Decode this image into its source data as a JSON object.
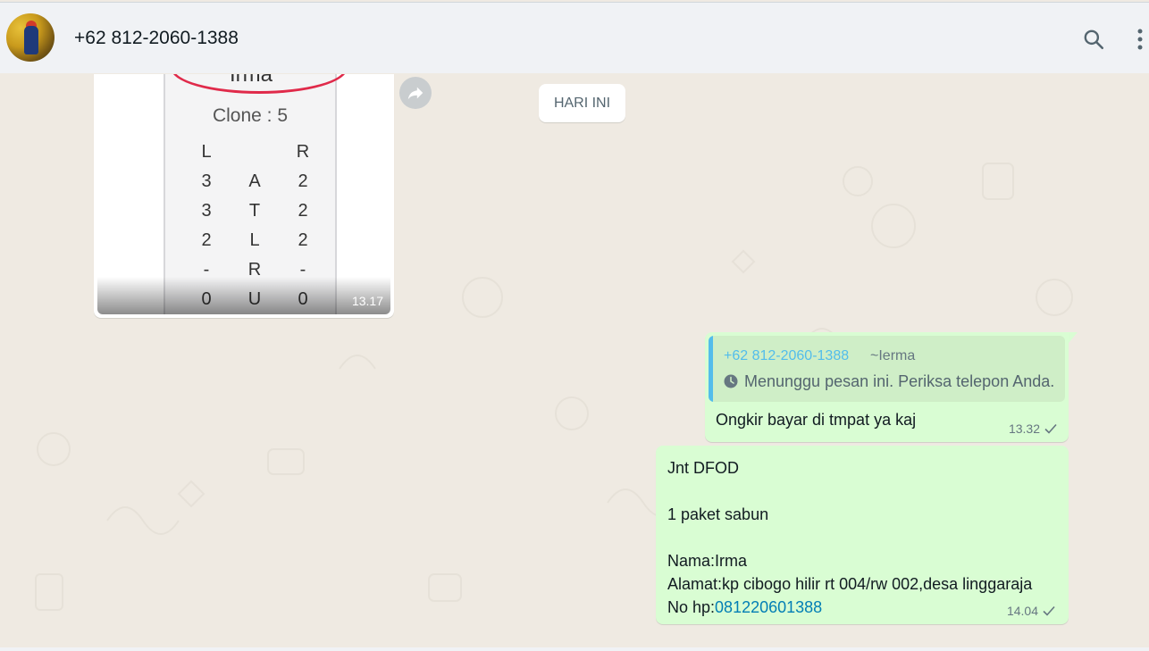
{
  "header": {
    "contact_name": "+62 812-2060-1388"
  },
  "chat": {
    "date_divider": "HARI INI",
    "image_message": {
      "label_irma": "Irma",
      "clone_label": "Clone : 5",
      "grid_rows": [
        [
          "L",
          "",
          "R"
        ],
        [
          "3",
          "A",
          "2"
        ],
        [
          "3",
          "T",
          "2"
        ],
        [
          "2",
          "L",
          "2"
        ],
        [
          "-",
          "R",
          "-"
        ],
        [
          "0",
          "U",
          "0"
        ]
      ],
      "time": "13.17"
    },
    "message_1": {
      "quoted_number": "+62 812-2060-1388",
      "quoted_alias": "~Ierma",
      "quoted_text": "Menunggu pesan ini. Periksa telepon Anda.",
      "text": "Ongkir bayar di tmpat ya kaj",
      "time": "13.32"
    },
    "message_2": {
      "line1": "Jnt DFOD",
      "line2": "1 paket sabun",
      "line3": "Nama:Irma",
      "line4": "Alamat:kp cibogo hilir rt 004/rw 002,desa linggaraja",
      "line5_prefix": "No hp:",
      "line5_link": "081220601388",
      "time": "14.04"
    }
  },
  "icons": {
    "search": "search-icon",
    "menu": "kebab-menu-icon",
    "forward": "forward-icon",
    "clock": "clock-icon",
    "check": "single-check-icon"
  },
  "colors": {
    "outgoing_bubble": "#d9fdd3",
    "quote_accent": "#53bdeb",
    "link": "#027eb5",
    "chat_background": "#efeae2"
  }
}
